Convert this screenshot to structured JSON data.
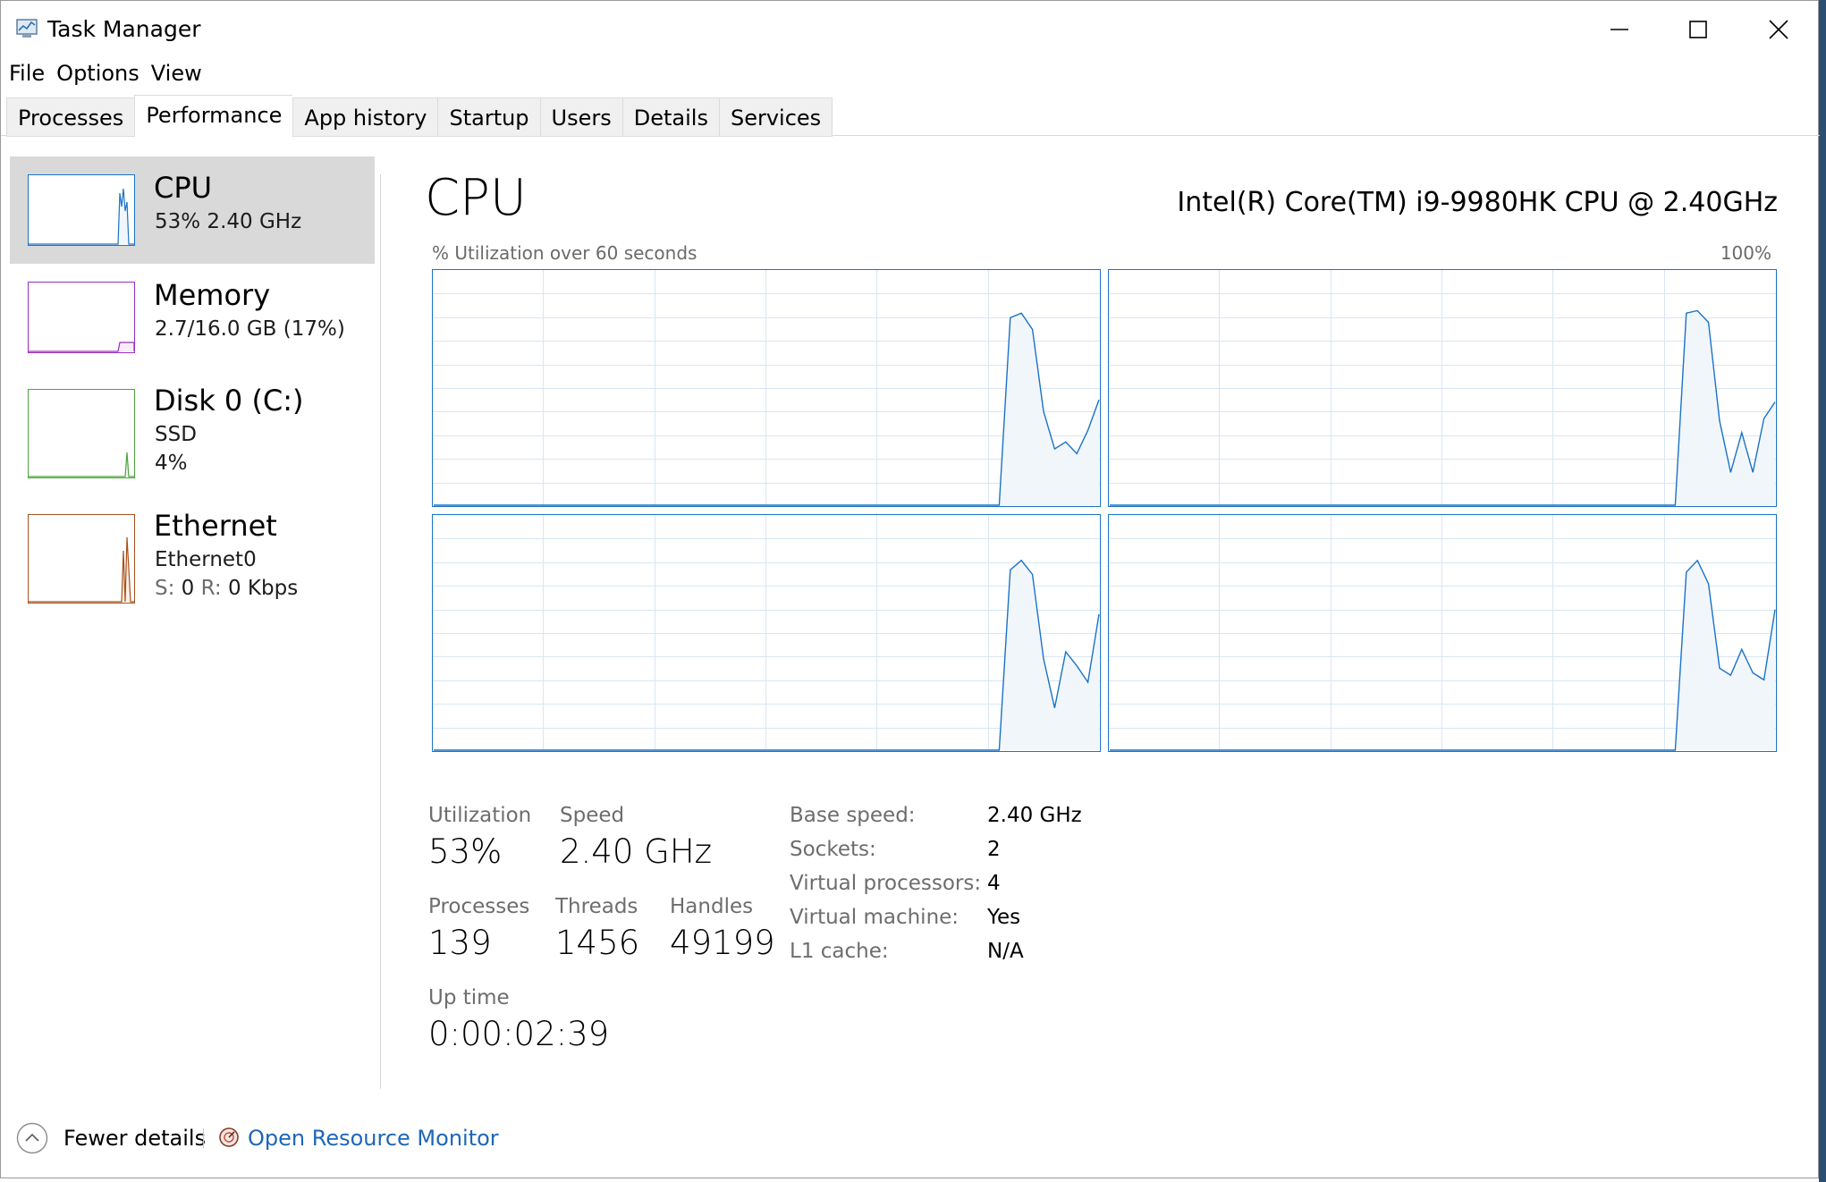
{
  "window": {
    "title": "Task Manager",
    "controls": {
      "minimize": "minimize-icon",
      "maximize": "maximize-icon",
      "close": "close-icon"
    }
  },
  "menu": [
    "File",
    "Options",
    "View"
  ],
  "tabs": [
    "Processes",
    "Performance",
    "App history",
    "Startup",
    "Users",
    "Details",
    "Services"
  ],
  "active_tab": "Performance",
  "sidebar": {
    "cpu": {
      "name": "CPU",
      "line1": "53%  2.40 GHz",
      "color": "#1a73c7"
    },
    "memory": {
      "name": "Memory",
      "line1": "2.7/16.0 GB (17%)",
      "color": "#9b2cbe"
    },
    "disk": {
      "name": "Disk 0 (C:)",
      "line1": "SSD",
      "line2": "4%",
      "color": "#4da43c"
    },
    "ethernet": {
      "name": "Ethernet",
      "line1": "Ethernet0",
      "s_label": "S:",
      "s_value": "0",
      "r_label": "R:",
      "r_value": "0 Kbps",
      "color": "#a7501a"
    }
  },
  "main": {
    "title": "CPU",
    "cpu_model": "Intel(R) Core(TM) i9-9980HK CPU @ 2.40GHz",
    "graph_caption": "% Utilization over 60 seconds",
    "graph_max": "100%",
    "stats": {
      "utilization_label": "Utilization",
      "utilization_value": "53%",
      "speed_label": "Speed",
      "speed_value": "2.40 GHz",
      "processes_label": "Processes",
      "processes_value": "139",
      "threads_label": "Threads",
      "threads_value": "1456",
      "handles_label": "Handles",
      "handles_value": "49199",
      "uptime_label": "Up time",
      "uptime_value": "0:00:02:39"
    },
    "details": [
      {
        "key": "Base speed:",
        "value": "2.40 GHz"
      },
      {
        "key": "Sockets:",
        "value": "2"
      },
      {
        "key": "Virtual processors:",
        "value": "4"
      },
      {
        "key": "Virtual machine:",
        "value": "Yes"
      },
      {
        "key": "L1 cache:",
        "value": "N/A"
      }
    ]
  },
  "footer": {
    "fewer_details": "Fewer details",
    "resource_monitor": "Open Resource Monitor"
  },
  "colors": {
    "cpu_line": "#1a73c7",
    "cpu_fill": "#f1f6fb",
    "grid": "#d8e6f3",
    "link": "#1e66b8"
  },
  "chart_data": [
    {
      "type": "area",
      "title": "",
      "x": [
        0,
        1,
        2,
        3,
        4,
        5,
        6,
        7,
        8,
        9,
        10,
        11,
        12,
        13,
        14,
        15,
        16,
        17,
        18,
        19,
        20,
        21,
        22,
        23,
        24,
        25,
        26,
        27,
        28,
        29,
        30,
        31,
        32,
        33,
        34,
        35,
        36,
        37,
        38,
        39,
        40,
        41,
        42,
        43,
        44,
        45,
        46,
        47,
        48,
        49,
        50,
        51,
        52,
        53,
        54,
        55,
        56,
        57,
        58,
        59,
        60
      ],
      "series": [
        {
          "values": [
            0,
            0,
            0,
            0,
            0,
            0,
            0,
            0,
            0,
            0,
            0,
            0,
            0,
            0,
            0,
            0,
            0,
            0,
            0,
            0,
            0,
            0,
            0,
            0,
            0,
            0,
            0,
            0,
            0,
            0,
            0,
            0,
            0,
            0,
            0,
            0,
            0,
            0,
            0,
            0,
            0,
            0,
            0,
            0,
            0,
            0,
            0,
            0,
            0,
            0,
            0,
            0,
            80,
            82,
            75,
            40,
            24,
            27,
            22,
            32,
            45
          ]
        }
      ],
      "ylim": [
        0,
        100
      ]
    },
    {
      "type": "area",
      "title": "",
      "x": [
        0,
        1,
        2,
        3,
        4,
        5,
        6,
        7,
        8,
        9,
        10,
        11,
        12,
        13,
        14,
        15,
        16,
        17,
        18,
        19,
        20,
        21,
        22,
        23,
        24,
        25,
        26,
        27,
        28,
        29,
        30,
        31,
        32,
        33,
        34,
        35,
        36,
        37,
        38,
        39,
        40,
        41,
        42,
        43,
        44,
        45,
        46,
        47,
        48,
        49,
        50,
        51,
        52,
        53,
        54,
        55,
        56,
        57,
        58,
        59,
        60
      ],
      "series": [
        {
          "values": [
            0,
            0,
            0,
            0,
            0,
            0,
            0,
            0,
            0,
            0,
            0,
            0,
            0,
            0,
            0,
            0,
            0,
            0,
            0,
            0,
            0,
            0,
            0,
            0,
            0,
            0,
            0,
            0,
            0,
            0,
            0,
            0,
            0,
            0,
            0,
            0,
            0,
            0,
            0,
            0,
            0,
            0,
            0,
            0,
            0,
            0,
            0,
            0,
            0,
            0,
            0,
            0,
            82,
            83,
            78,
            36,
            14,
            31,
            14,
            37,
            44
          ]
        }
      ],
      "ylim": [
        0,
        100
      ]
    },
    {
      "type": "area",
      "title": "",
      "x": [
        0,
        1,
        2,
        3,
        4,
        5,
        6,
        7,
        8,
        9,
        10,
        11,
        12,
        13,
        14,
        15,
        16,
        17,
        18,
        19,
        20,
        21,
        22,
        23,
        24,
        25,
        26,
        27,
        28,
        29,
        30,
        31,
        32,
        33,
        34,
        35,
        36,
        37,
        38,
        39,
        40,
        41,
        42,
        43,
        44,
        45,
        46,
        47,
        48,
        49,
        50,
        51,
        52,
        53,
        54,
        55,
        56,
        57,
        58,
        59,
        60
      ],
      "series": [
        {
          "values": [
            0,
            0,
            0,
            0,
            0,
            0,
            0,
            0,
            0,
            0,
            0,
            0,
            0,
            0,
            0,
            0,
            0,
            0,
            0,
            0,
            0,
            0,
            0,
            0,
            0,
            0,
            0,
            0,
            0,
            0,
            0,
            0,
            0,
            0,
            0,
            0,
            0,
            0,
            0,
            0,
            0,
            0,
            0,
            0,
            0,
            0,
            0,
            0,
            0,
            0,
            0,
            0,
            77,
            81,
            75,
            39,
            18,
            42,
            36,
            29,
            58
          ]
        }
      ],
      "ylim": [
        0,
        100
      ]
    },
    {
      "type": "area",
      "title": "",
      "x": [
        0,
        1,
        2,
        3,
        4,
        5,
        6,
        7,
        8,
        9,
        10,
        11,
        12,
        13,
        14,
        15,
        16,
        17,
        18,
        19,
        20,
        21,
        22,
        23,
        24,
        25,
        26,
        27,
        28,
        29,
        30,
        31,
        32,
        33,
        34,
        35,
        36,
        37,
        38,
        39,
        40,
        41,
        42,
        43,
        44,
        45,
        46,
        47,
        48,
        49,
        50,
        51,
        52,
        53,
        54,
        55,
        56,
        57,
        58,
        59,
        60
      ],
      "series": [
        {
          "values": [
            0,
            0,
            0,
            0,
            0,
            0,
            0,
            0,
            0,
            0,
            0,
            0,
            0,
            0,
            0,
            0,
            0,
            0,
            0,
            0,
            0,
            0,
            0,
            0,
            0,
            0,
            0,
            0,
            0,
            0,
            0,
            0,
            0,
            0,
            0,
            0,
            0,
            0,
            0,
            0,
            0,
            0,
            0,
            0,
            0,
            0,
            0,
            0,
            0,
            0,
            0,
            0,
            76,
            81,
            71,
            35,
            32,
            43,
            33,
            30,
            60
          ]
        }
      ],
      "ylim": [
        0,
        100
      ]
    }
  ]
}
